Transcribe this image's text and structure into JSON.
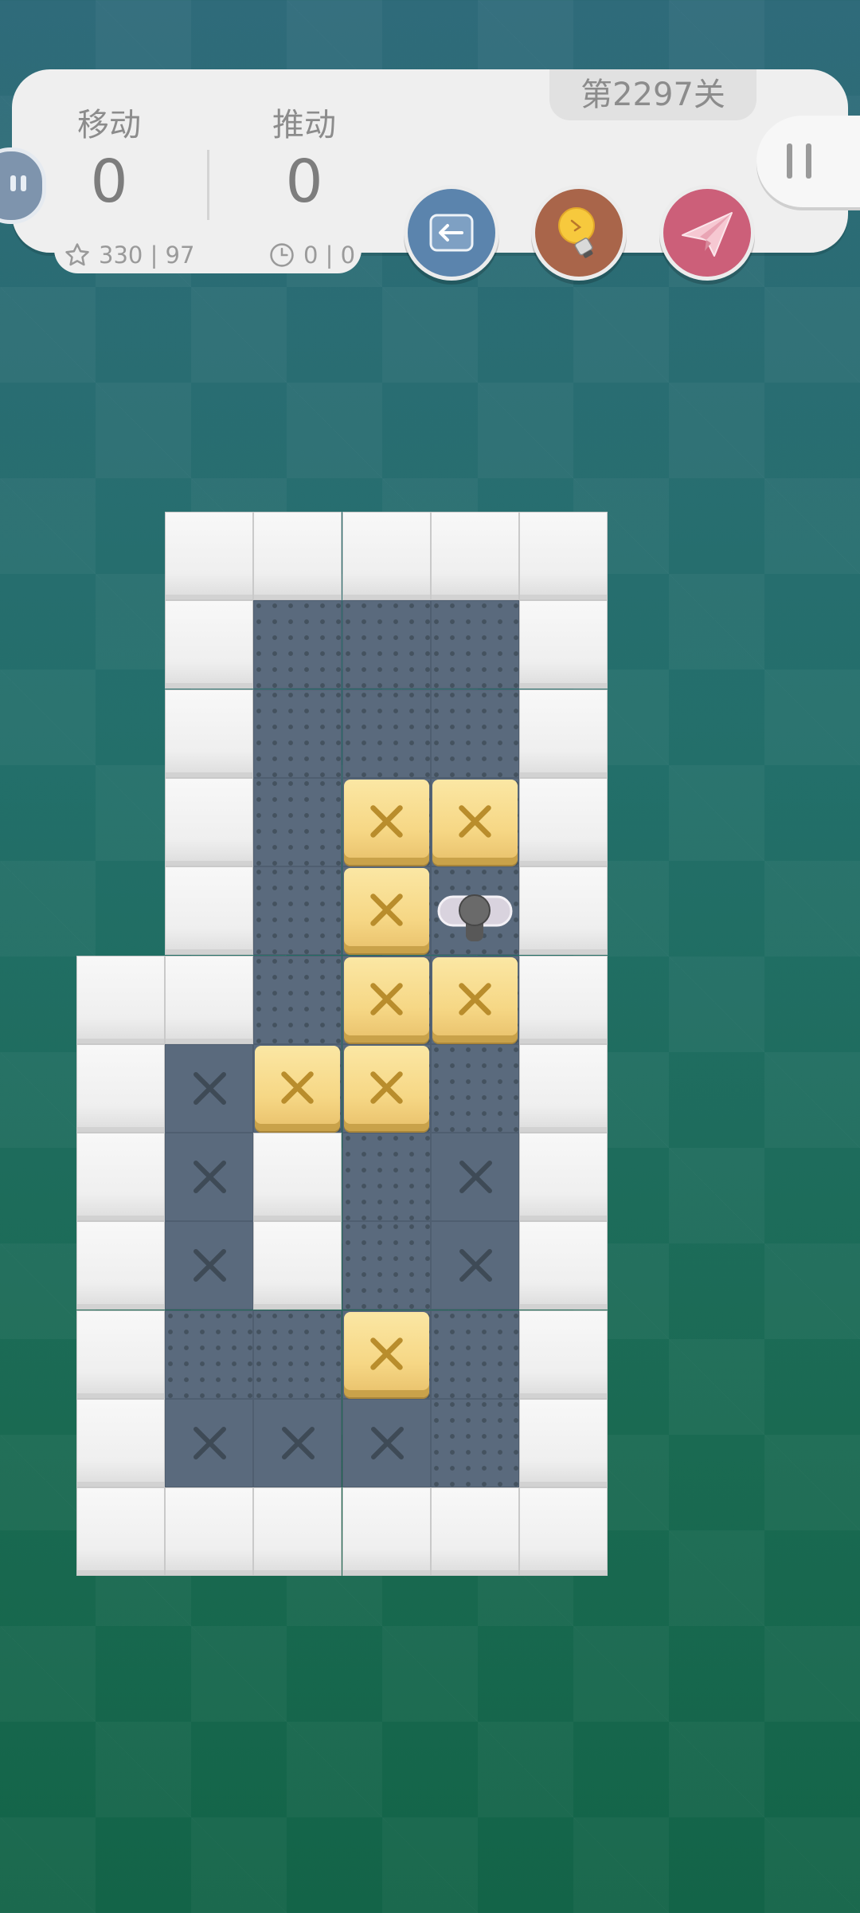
{
  "header": {
    "moves_label": "移动",
    "moves_value": "0",
    "pushes_label": "推动",
    "pushes_value": "0",
    "stars_text": "330 | 97",
    "time_text": "0 | 0",
    "level_label": "第2297关"
  },
  "buttons": {
    "undo_icon": "undo-arrow-icon",
    "hint_icon": "lightbulb-icon",
    "share_icon": "paper-plane-icon",
    "pause_icon": "pause-icon"
  },
  "colors": {
    "undo": "#5b84ad",
    "hint": "#a9654a",
    "share": "#cc5f79",
    "box": "#f6d785",
    "floor": "#5a6a7d",
    "wall": "#f0f0f0"
  },
  "board": {
    "rows": [
      ". W W W W W",
      ". W F F F W",
      ". W F F F W",
      ". W F B B W",
      ". W F B P W",
      "W W F B B W",
      "W G B B F W",
      "W G W F G W",
      "W G W F G W",
      "W F F B F W",
      "W G G G F W",
      "W W W W W W"
    ],
    "legend": {
      "W": "wall",
      "F": "floor",
      "G": "goal",
      "B": "box",
      "P": "player",
      ".": "empty"
    }
  }
}
